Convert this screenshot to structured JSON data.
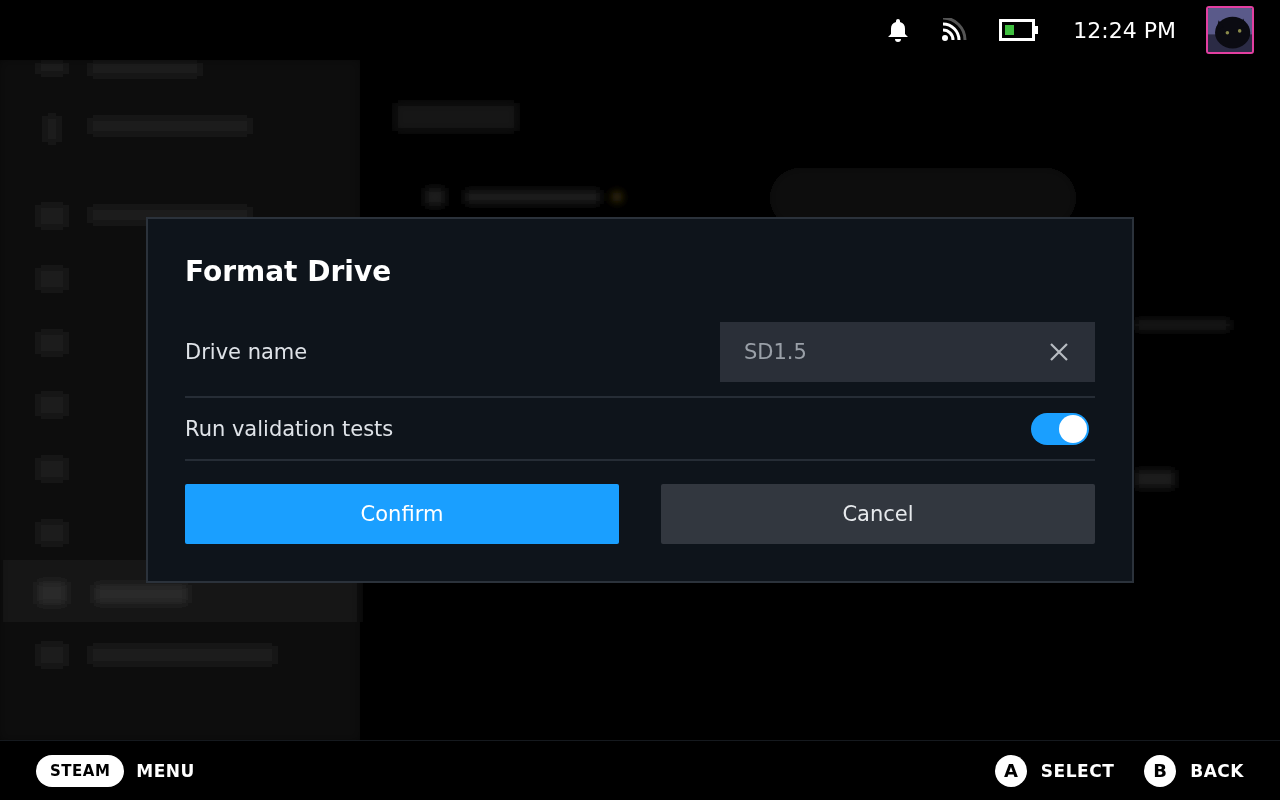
{
  "status_bar": {
    "time": "12:24 PM"
  },
  "dialog": {
    "title": "Format Drive",
    "rows": [
      {
        "kind": "text",
        "label": "Drive name",
        "value": "SD1.5"
      },
      {
        "kind": "toggle",
        "label": "Run validation tests",
        "on": true
      }
    ],
    "buttons": [
      {
        "label": "Confirm",
        "primary": true
      },
      {
        "label": "Cancel",
        "primary": false
      }
    ]
  },
  "footer": {
    "left": [
      {
        "key": "STEAM",
        "label": "MENU"
      }
    ],
    "right": [
      {
        "key": "A",
        "label": "SELECT"
      },
      {
        "key": "B",
        "label": "BACK"
      }
    ]
  }
}
